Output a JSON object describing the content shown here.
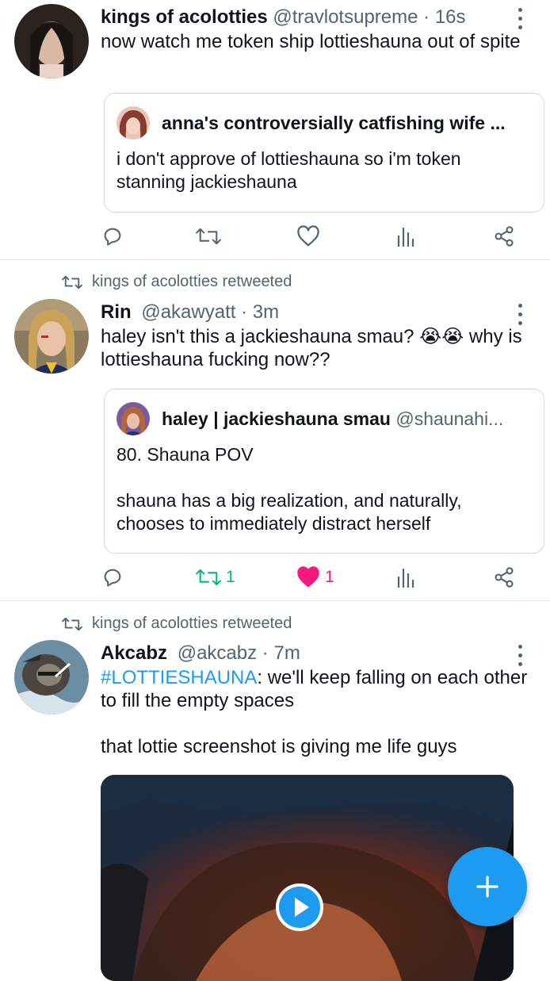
{
  "tweets": [
    {
      "name": "kings of acolotties",
      "handle": "@travlotsupreme",
      "dot": "·",
      "time": "16s",
      "text": "now watch me token ship lottieshauna out of spite",
      "quote": {
        "name": "anna's controversially catfishing wife ...",
        "handle": "",
        "text": "i don't approve of lottieshauna so i'm token stanning jackieshauna"
      },
      "retweet_count": "",
      "like_count": ""
    },
    {
      "retweeted_by": "kings of acolotties retweeted",
      "name": "Rin",
      "handle": "@akawyatt",
      "dot": "·",
      "time": "3m",
      "text_before_emoji": "haley isn't this a jackieshauna smau?",
      "emoji": "😭😭",
      "text_after_emoji": "why is lottieshauna fucking now??",
      "quote": {
        "name": "haley | jackieshauna smau",
        "handle": "@shaunahi...",
        "text_line1": "80. Shauna POV",
        "text_line2": "shauna has a big realization, and naturally, chooses to immediately distract herself"
      },
      "retweet_count": "1",
      "like_count": "1",
      "retweeted": true,
      "liked": true
    },
    {
      "retweeted_by": "kings of acolotties retweeted",
      "name": "Akcabz",
      "handle": "@akcabz",
      "dot": "·",
      "time": "7m",
      "hashtag": "#LOTTIESHAUNA",
      "text_rest": ": we'll keep falling on each other to fill the empty spaces",
      "text2": "that lottie screenshot is giving me life guys"
    }
  ],
  "icons": {
    "reply": "reply-icon",
    "retweet": "retweet-icon",
    "like": "heart-icon",
    "views": "analytics-icon",
    "share": "share-icon",
    "more": "more-vertical-icon",
    "play": "play-icon",
    "compose": "plus-icon"
  },
  "colors": {
    "accent": "#1d9bf0",
    "retweet_active": "#00ba7c",
    "like_active": "#f91880",
    "secondary_text": "#536471"
  }
}
